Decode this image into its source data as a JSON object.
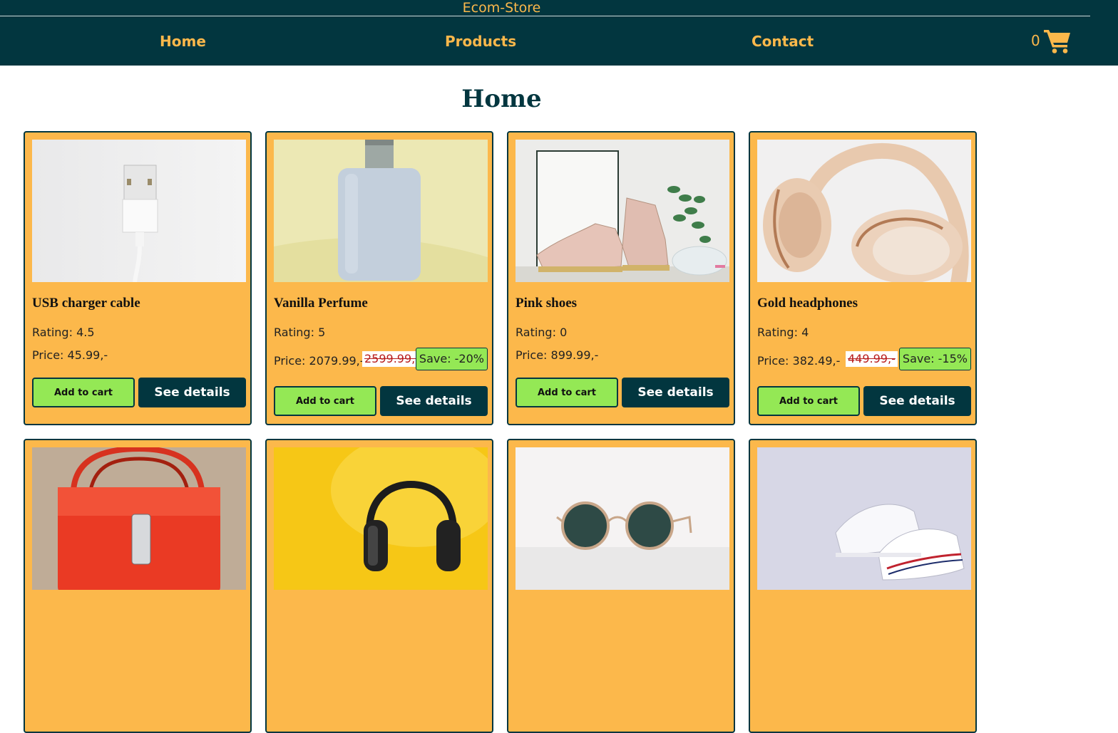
{
  "header": {
    "brand": "Ecom-Store",
    "nav": [
      {
        "label": "Home"
      },
      {
        "label": "Products"
      },
      {
        "label": "Contact"
      }
    ],
    "cart_count": "0",
    "cart_icon": "shopping-cart-icon"
  },
  "page": {
    "title": "Home"
  },
  "colors": {
    "header_bg": "#02363f",
    "accent": "#fcb84b",
    "card_bg": "#fcb84b",
    "add_to_cart_bg": "#94e855",
    "details_bg": "#02363f"
  },
  "products": [
    {
      "name": "USB charger cable",
      "rating": "Rating: 4.5",
      "price": "Price: 45.99,-",
      "add_label": "Add to cart",
      "details_label": "See details"
    },
    {
      "name": "Vanilla Perfume",
      "rating": "Rating: 5",
      "price": "Price: 2079.99,-",
      "old_price": "2599.99,-",
      "save": "Save: -20%",
      "add_label": "Add to cart",
      "details_label": "See details"
    },
    {
      "name": "Pink shoes",
      "rating": "Rating: 0",
      "price": "Price: 899.99,-",
      "add_label": "Add to cart",
      "details_label": "See details"
    },
    {
      "name": "Gold headphones",
      "rating": "Rating: 4",
      "price": "Price: 382.49,-",
      "old_price": "449.99,-",
      "save": "Save: -15%",
      "add_label": "Add to cart",
      "details_label": "See details"
    },
    {
      "image": "red-handbag"
    },
    {
      "image": "black-headphones"
    },
    {
      "image": "round-sunglasses"
    },
    {
      "image": "white-sneakers"
    }
  ]
}
